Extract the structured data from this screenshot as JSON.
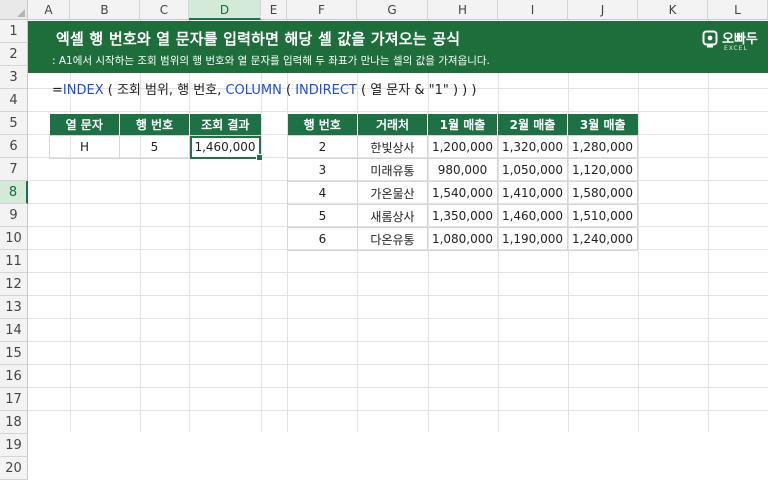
{
  "columns": [
    "A",
    "B",
    "C",
    "D",
    "E",
    "F",
    "G",
    "H",
    "I",
    "J",
    "K",
    "L"
  ],
  "selected_column": "D",
  "rows": [
    "1",
    "2",
    "3",
    "4",
    "5",
    "6",
    "7",
    "8",
    "9",
    "10",
    "11",
    "12",
    "13",
    "14",
    "15",
    "16",
    "17",
    "18",
    "19",
    "20"
  ],
  "selected_row": "8",
  "banner": {
    "title": "엑셀 행 번호와 열 문자를 입력하면 해당 셀 값을 가져오는 공식",
    "subtitle": ": A1에서 시작하는 조회 범위의 행 번호와 열 문자를 입력해 두 좌표가 만나는 셀의 값을 가져옵니다.",
    "logo_text": "오빠두",
    "logo_sub": "EXCEL",
    "bg_color": "#1e6e3c"
  },
  "formula": {
    "eq": "=",
    "fn1": "INDEX",
    "p1": " ( 조회 범위, 행 번호, ",
    "fn2": "COLUMN",
    "p2": " ( ",
    "fn3": "INDIRECT",
    "p3": " ( 열 문자 & \"1\" ) ) )"
  },
  "lookup": {
    "headers": [
      "열 문자",
      "행 번호",
      "조회 결과"
    ],
    "row": [
      "H",
      "5",
      "1,460,000"
    ]
  },
  "sales": {
    "headers": [
      "행 번호",
      "거래처",
      "1월 매출",
      "2월 매출",
      "3월 매출"
    ],
    "rows": [
      [
        "2",
        "한빛상사",
        "1,200,000",
        "1,320,000",
        "1,280,000"
      ],
      [
        "3",
        "미래유통",
        "980,000",
        "1,050,000",
        "1,120,000"
      ],
      [
        "4",
        "가온물산",
        "1,540,000",
        "1,410,000",
        "1,580,000"
      ],
      [
        "5",
        "새롬상사",
        "1,350,000",
        "1,460,000",
        "1,510,000"
      ],
      [
        "6",
        "다온유통",
        "1,080,000",
        "1,190,000",
        "1,240,000"
      ]
    ]
  },
  "accent_color": "#217346"
}
